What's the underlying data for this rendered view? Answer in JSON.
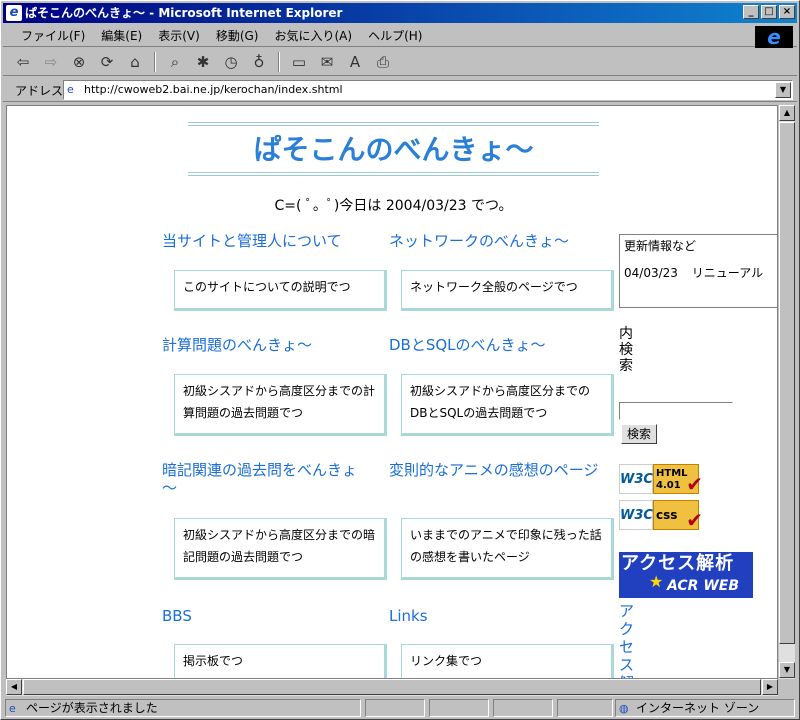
{
  "window": {
    "title": "ぱそこんのべんきょ～ - Microsoft Internet Explorer"
  },
  "menu": [
    "ファイル(F)",
    "編集(E)",
    "表示(V)",
    "移動(G)",
    "お気に入り(A)",
    "ヘルプ(H)"
  ],
  "address": {
    "label": "アドレス",
    "url": "http://cwoweb2.bai.ne.jp/kerochan/index.shtml"
  },
  "page": {
    "title": "ぱそこんのべんきょ～",
    "date_prefix": "C=( ﾟ。ﾟ)今日は",
    "date": "2004/03/23",
    "date_suffix": "でつ。",
    "sections": [
      {
        "title": "当サイトと管理人について",
        "desc": "このサイトについての説明でつ"
      },
      {
        "title": "ネットワークのべんきょ～",
        "desc": "ネットワーク全般のページでつ"
      },
      {
        "title": "計算問題のべんきょ～",
        "desc": "初級シスアドから高度区分までの計算問題の過去問題でつ"
      },
      {
        "title": "DBとSQLのべんきょ～",
        "desc": "初級シスアドから高度区分までのDBとSQLの過去問題でつ"
      },
      {
        "title": "暗記関連の過去問をべんきょ～",
        "desc": "初級シスアドから高度区分までの暗記問題の過去問題でつ"
      },
      {
        "title": "変則的なアニメの感想のページ",
        "desc": "いままでのアニメで印象に残った話の感想を書いたページ"
      },
      {
        "title": "BBS",
        "desc": "掲示板でつ"
      },
      {
        "title": "Links",
        "desc": "リンク集でつ"
      }
    ],
    "news": {
      "heading": "更新情報など",
      "date": "04/03/23",
      "text": "リニューアル"
    },
    "search_label": "内検索",
    "search_button": "検索",
    "badges": {
      "html": "HTML 4.01",
      "css": "css",
      "w3c": "W3C"
    },
    "acr": {
      "line1": "アクセス解析",
      "line2": "ACR WEB"
    },
    "access_link": "アクセス解"
  },
  "status": {
    "message": "ページが表示されました",
    "zone": "インターネット ゾーン"
  }
}
